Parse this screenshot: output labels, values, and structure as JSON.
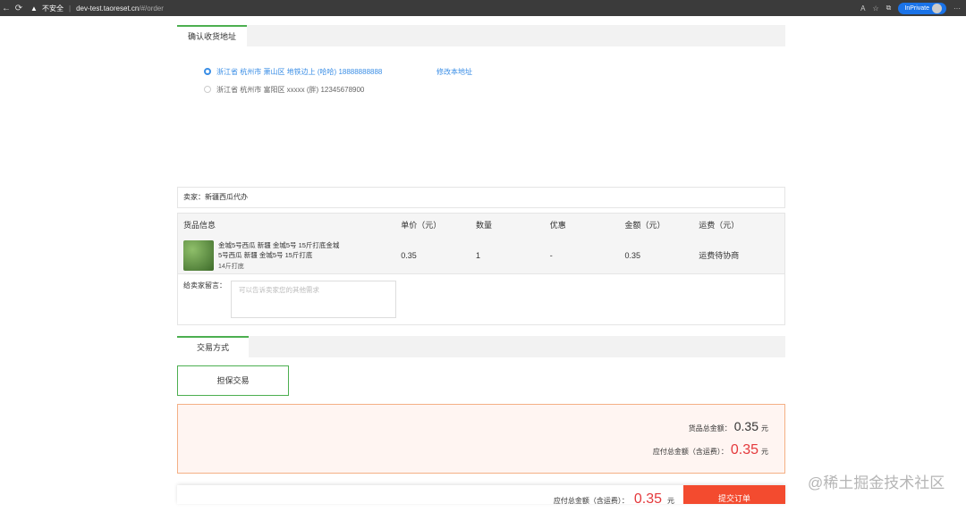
{
  "browser": {
    "back": "←",
    "reload": "⟳",
    "warning": "▲",
    "insecure": "不安全",
    "separator": "|",
    "url_host": "dev-test.taoreset.cn",
    "url_path": "/#/order",
    "inprivate": "InPrivate",
    "menu": "···",
    "read_aloud": "A",
    "fav": "☆",
    "collections": "⧉"
  },
  "address_section": {
    "title": "确认收货地址",
    "selected": "浙江省 杭州市 萧山区 地铁边上 (哈哈) 18888888888",
    "edit": "修改本地址",
    "other": "浙江省 杭州市 富阳区 xxxxx (胖) 12345678900"
  },
  "seller": {
    "label": "卖家：新疆西瓜代办"
  },
  "goods": {
    "headers": [
      "货品信息",
      "单价（元）",
      "数量",
      "优惠",
      "金额（元）",
      "运费（元）"
    ],
    "item": {
      "name": "金城5号西瓜 新疆 金城5号 15斤打底金城5号西瓜 新疆 金城5号 15斤打底",
      "spec": "14斤打底",
      "price": "0.35",
      "qty": "1",
      "discount": "-",
      "amount": "0.35",
      "shipping": "运费待协商"
    },
    "message_label": "给卖家留言：",
    "message_placeholder": "可以告诉卖家您的其他需求"
  },
  "payment": {
    "title": "交易方式",
    "option": "担保交易"
  },
  "totals": {
    "goods_label": "货品总金额：",
    "goods_amount": "0.35",
    "unit": "元",
    "payable_label": "应付总金额（含运费）：",
    "payable_amount": "0.35"
  },
  "footer": {
    "label": "应付总金额（含运费）：",
    "amount": "0.35",
    "unit": "元",
    "submit": "提交订单"
  },
  "watermark": "@稀土掘金技术社区",
  "colors": {
    "accent_blue": "#3a8ee6",
    "green": "#4caf50",
    "red": "#e4393c",
    "submit": "#f34b2f"
  }
}
